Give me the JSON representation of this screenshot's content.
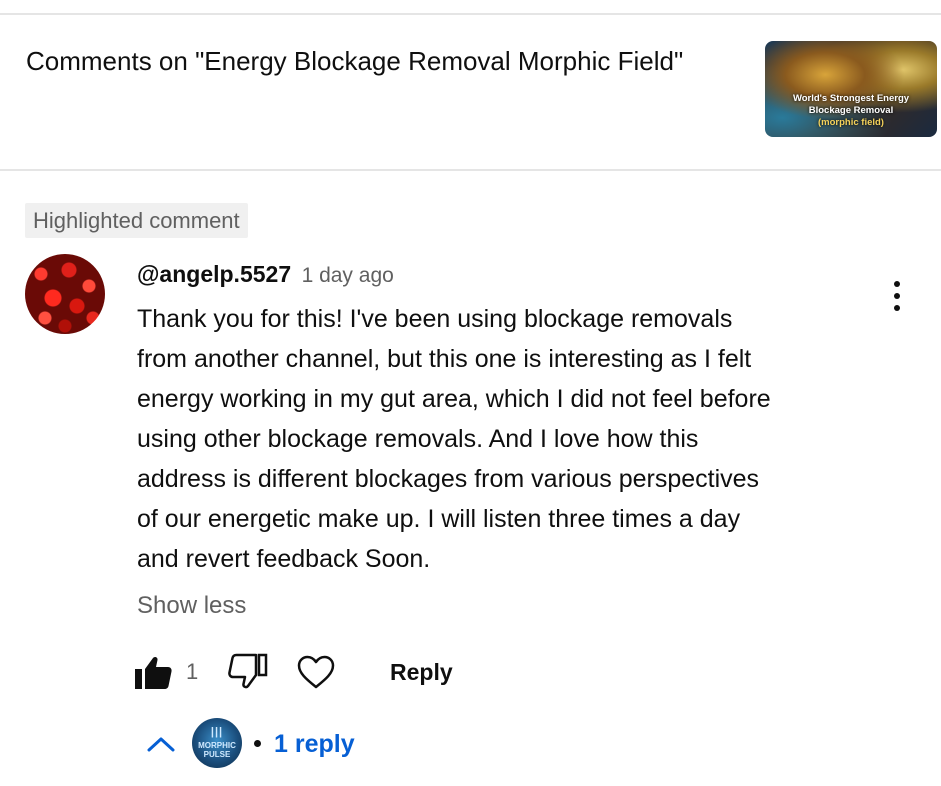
{
  "header": {
    "title": "Comments on \"Energy Blockage Removal Morphic Field\"",
    "thumbnail": {
      "line1": "World's Strongest Energy",
      "line2": "Blockage Removal",
      "line3": "(morphic field)"
    }
  },
  "comment": {
    "badge": "Highlighted comment",
    "author": "@angelp.5527",
    "time": "1 day ago",
    "lines": [
      "Thank you for this! I've been using blockage removals",
      "from another channel, but this one is interesting as I felt",
      "energy working in my gut area, which I did not feel before",
      "using other blockage removals. And I love how this",
      "address is different blockages from various perspectives",
      "of our energetic make up. I will listen three times a day",
      "and revert feedback Soon."
    ],
    "show_less": "Show less",
    "likes": "1",
    "reply_label": "Reply",
    "liked": true
  },
  "replies": {
    "count_label": "1 reply",
    "separator": "•",
    "channel_avatar": {
      "line1": "MORPHIC",
      "line2": "PULSE"
    }
  },
  "icons": {
    "like": "thumbs-up-icon",
    "dislike": "thumbs-down-icon",
    "heart": "heart-icon",
    "menu": "more-vertical-icon",
    "chevron": "chevron-up-icon"
  },
  "colors": {
    "link": "#065fd4",
    "secondary_text": "#606060",
    "primary_text": "#0f0f0f",
    "badge_bg": "#f0f0f0"
  }
}
